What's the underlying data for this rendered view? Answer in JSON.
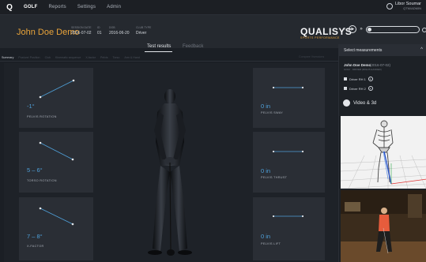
{
  "topbar": {
    "logo": "Q",
    "nav": [
      "GOLF",
      "Reports",
      "Settings",
      "Admin"
    ],
    "user_name": "Libor Soumar",
    "user_sub": "QTM/ADMIN"
  },
  "header": {
    "client_name": "John Doe Demo",
    "meta": [
      {
        "label": "SESSION DATE",
        "value": "2016-07-02"
      },
      {
        "label": "ID",
        "value": "01"
      },
      {
        "label": "DOB",
        "value": "2016-06-20"
      },
      {
        "label": "CLUB TYPE",
        "value": "Driver"
      }
    ],
    "brand_name": "QUALISYS",
    "brand_sub": "SPORTS PERFORMANCE",
    "player": {
      "rewind": "«",
      "play": "▶",
      "forward": "»"
    }
  },
  "tabs": [
    {
      "label": "Test results",
      "active": true
    },
    {
      "label": "Feedback",
      "active": false
    }
  ],
  "subnav": {
    "items": [
      "Summary",
      "Posture/ Position",
      "Club",
      "Kinematic sequence",
      "X-factor",
      "Pelvis",
      "Torso",
      "Arm & Hand"
    ],
    "right": "Compare Vsessions"
  },
  "cards": [
    {
      "value": "-1°",
      "label": "PELVIS ROTATION"
    },
    {
      "value": "5 – 6°",
      "label": "TORSO ROTATION"
    },
    {
      "value": "7 – 8°",
      "label": "X-FACTOR"
    },
    {
      "value": "0 in",
      "label": "PELVIS SWAY"
    },
    {
      "value": "0 in",
      "label": "PELVIS THRUST"
    },
    {
      "value": "0 in",
      "label": "PELVIS LIFT"
    }
  ],
  "side": {
    "title": "Select measurements",
    "collapse": "^",
    "session_name": "John Doe Demo",
    "session_date": "(2016-07-02)",
    "session_sub": "GOLF · DRIVER (RIGHT-HANDED)",
    "measurements": [
      "Driver RH 1",
      "Driver RH 2"
    ],
    "video_label": "Video & 3d"
  },
  "colors": {
    "accent_orange": "#e8a33a",
    "value_blue": "#4fa0d9",
    "card_bg": "#2a2e35"
  }
}
